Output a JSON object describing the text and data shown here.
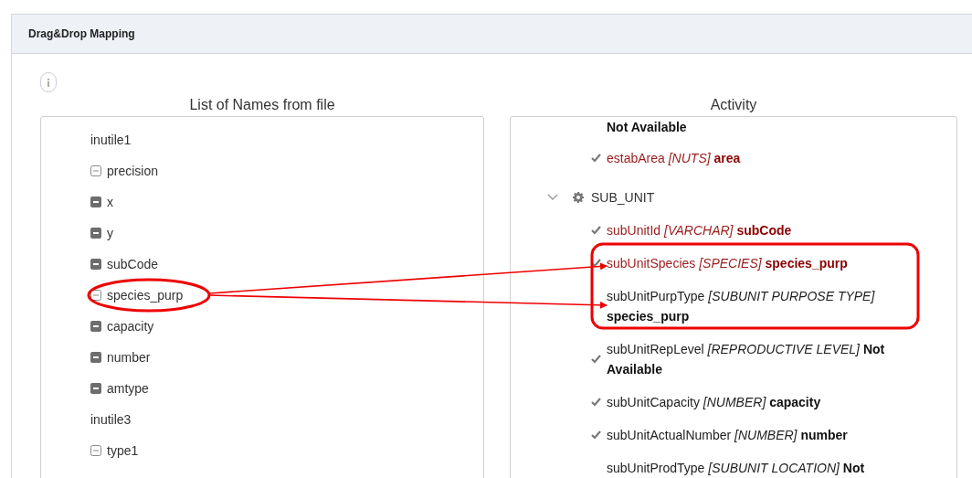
{
  "panel": {
    "title": "Drag&Drop Mapping"
  },
  "file_names": {
    "title": "List of Names from file",
    "items": [
      {
        "kind": "plain",
        "label": "inutile1"
      },
      {
        "kind": "outline",
        "label": "precision"
      },
      {
        "kind": "filled",
        "label": "x"
      },
      {
        "kind": "filled",
        "label": "y"
      },
      {
        "kind": "filled",
        "label": "subCode"
      },
      {
        "kind": "outline",
        "label": "species_purp"
      },
      {
        "kind": "filled",
        "label": "capacity"
      },
      {
        "kind": "filled",
        "label": "number"
      },
      {
        "kind": "filled",
        "label": "amtype"
      },
      {
        "kind": "plain",
        "label": "inutile3"
      },
      {
        "kind": "outline",
        "label": "type1"
      }
    ]
  },
  "activity": {
    "title": "Activity",
    "items": [
      {
        "kind": "tail",
        "text": "**Not Available**"
      },
      {
        "kind": "field",
        "checked": true,
        "highlighted": true,
        "text": "estabArea *[NUTS]* **area**"
      },
      {
        "kind": "group",
        "expanded": true,
        "text": "SUB_UNIT"
      },
      {
        "kind": "field",
        "checked": true,
        "highlighted": true,
        "text": "subUnitId *[VARCHAR]* **subCode**"
      },
      {
        "kind": "field",
        "checked": true,
        "highlighted": true,
        "text": "subUnitSpecies *[SPECIES]* **species_purp**"
      },
      {
        "kind": "field",
        "checked": false,
        "highlighted": false,
        "text": "subUnitPurpType *[SUBUNIT PURPOSE TYPE]* **species_purp**"
      },
      {
        "kind": "field",
        "checked": true,
        "highlighted": false,
        "text": "subUnitRepLevel *[REPRODUCTIVE LEVEL]* **Not Available**"
      },
      {
        "kind": "field",
        "checked": true,
        "highlighted": false,
        "text": "subUnitCapacity *[NUMBER]* **capacity**"
      },
      {
        "kind": "field",
        "checked": true,
        "highlighted": false,
        "text": "subUnitActualNumber *[NUMBER]* **number**"
      },
      {
        "kind": "field",
        "checked": false,
        "highlighted": false,
        "text": "subUnitProdType *[SUBUNIT LOCATION]* **Not**"
      }
    ]
  }
}
